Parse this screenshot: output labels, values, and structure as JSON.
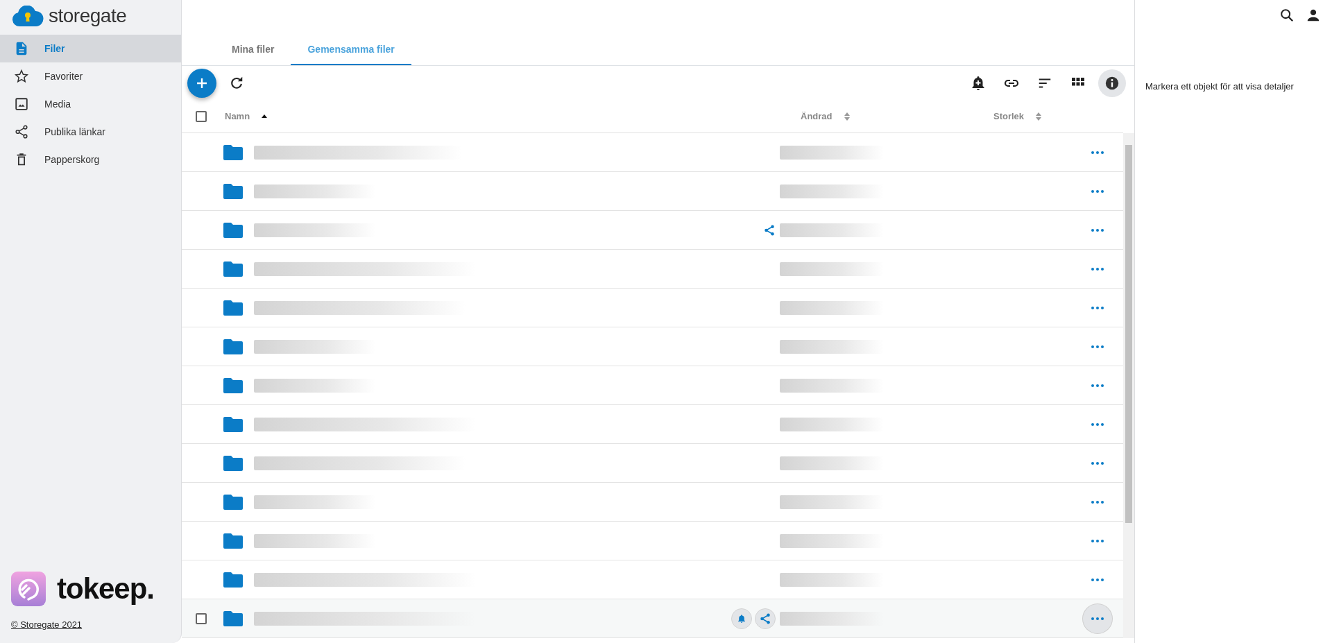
{
  "sidebar": {
    "logo": "storegate",
    "items": [
      {
        "label": "Filer",
        "selected": true
      },
      {
        "label": "Favoriter",
        "selected": false
      },
      {
        "label": "Media",
        "selected": false
      },
      {
        "label": "Publika länkar",
        "selected": false
      },
      {
        "label": "Papperskorg",
        "selected": false
      }
    ],
    "partner_logo": "tokeep.",
    "copyright": "© Storegate 2021"
  },
  "tabs": [
    {
      "label": "Mina filer",
      "selected": false
    },
    {
      "label": "Gemensamma filer",
      "selected": true
    }
  ],
  "table": {
    "select_all_checked": false,
    "columns": [
      {
        "label": "Namn",
        "kind": "sorted"
      },
      {
        "label": "Ändrad",
        "kind": "sortable"
      },
      {
        "label": "Storlek",
        "kind": "sortable"
      }
    ],
    "rows": [
      {
        "shared": false,
        "notify": false,
        "hovered": false
      },
      {
        "shared": false,
        "notify": false,
        "hovered": false
      },
      {
        "shared": true,
        "notify": false,
        "hovered": false
      },
      {
        "shared": false,
        "notify": false,
        "hovered": false
      },
      {
        "shared": false,
        "notify": false,
        "hovered": false
      },
      {
        "shared": false,
        "notify": false,
        "hovered": false
      },
      {
        "shared": false,
        "notify": false,
        "hovered": false
      },
      {
        "shared": false,
        "notify": false,
        "hovered": false
      },
      {
        "shared": false,
        "notify": false,
        "hovered": false
      },
      {
        "shared": false,
        "notify": false,
        "hovered": false
      },
      {
        "shared": false,
        "notify": false,
        "hovered": false
      },
      {
        "shared": false,
        "notify": false,
        "hovered": false
      },
      {
        "shared": true,
        "notify": true,
        "hovered": true
      }
    ]
  },
  "details_panel": {
    "message": "Markera ett objekt för att visa detaljer"
  }
}
